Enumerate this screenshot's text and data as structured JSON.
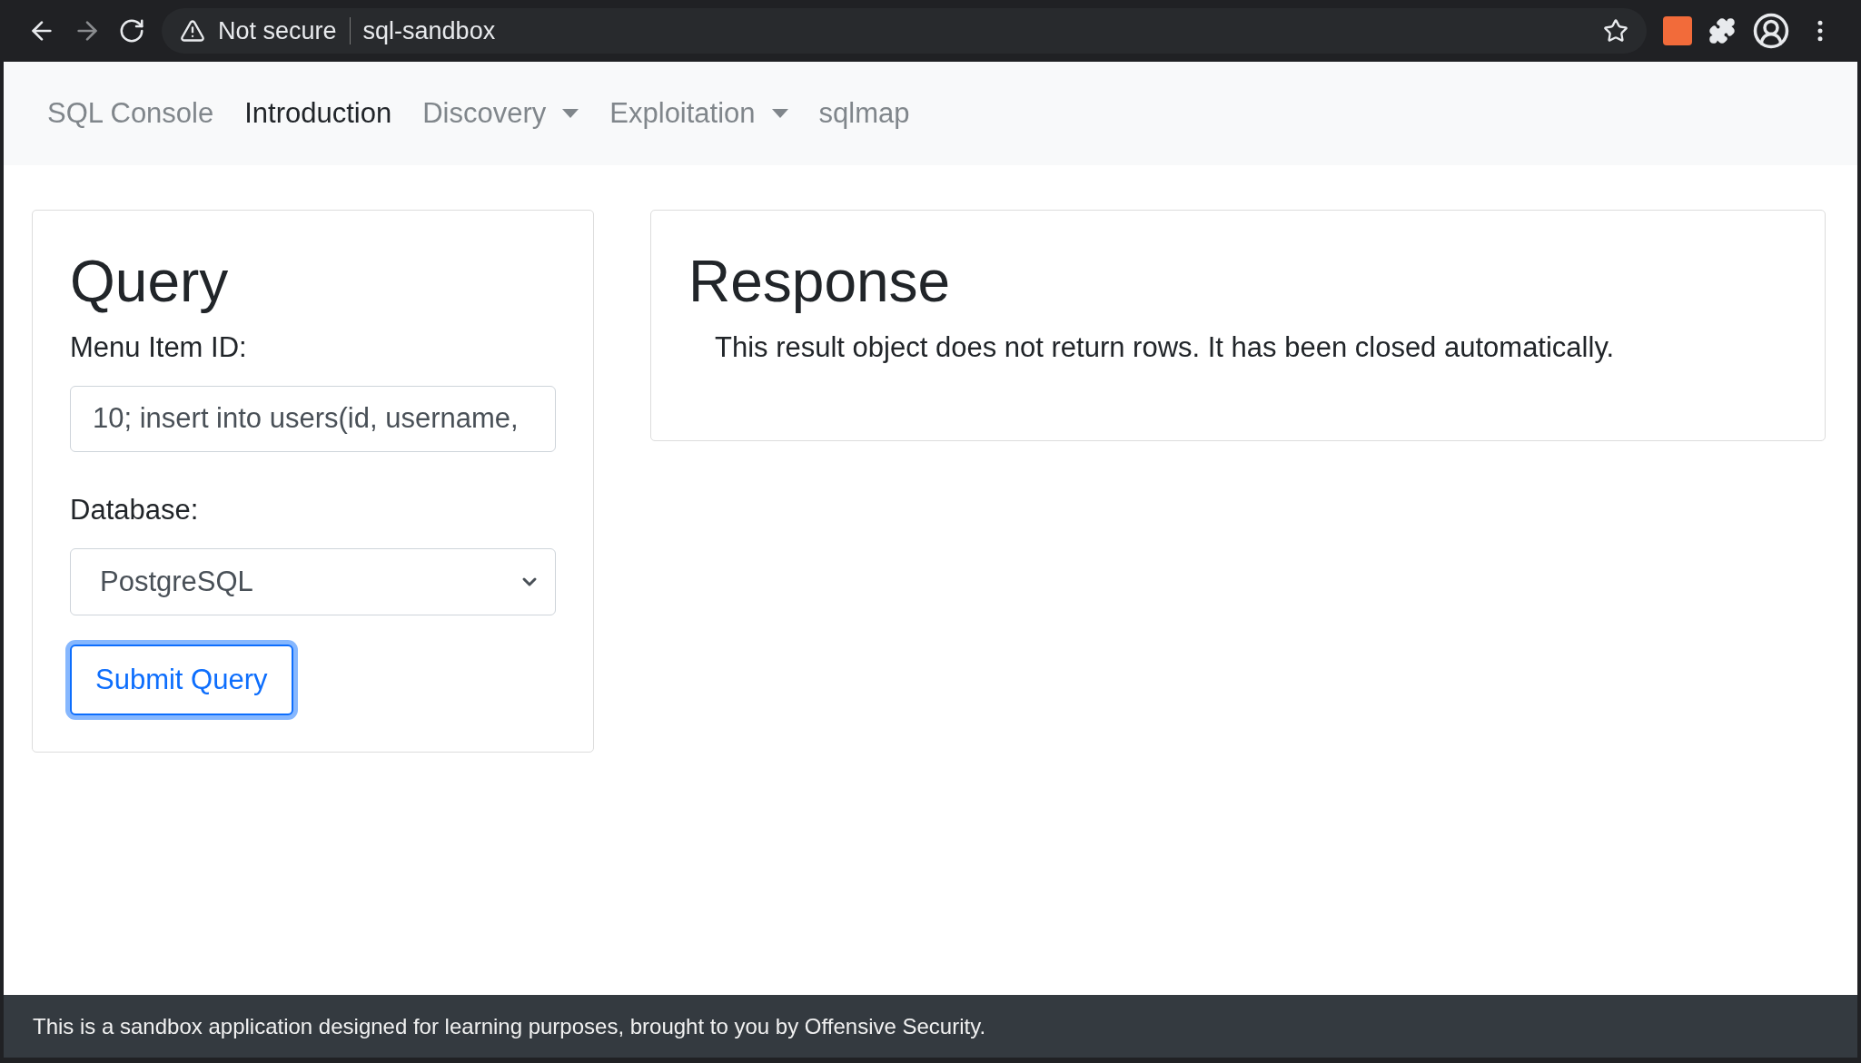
{
  "browser": {
    "security": "Not secure",
    "url": "sql-sandbox"
  },
  "nav": [
    {
      "label": "SQL Console",
      "selected": false,
      "kind": "link"
    },
    {
      "label": "Introduction",
      "selected": true,
      "kind": "link"
    },
    {
      "label": "Discovery",
      "selected": false,
      "kind": "dropdown"
    },
    {
      "label": "Exploitation",
      "selected": false,
      "kind": "dropdown"
    },
    {
      "label": "sqlmap",
      "selected": false,
      "kind": "link"
    }
  ],
  "query": {
    "title": "Query",
    "id_label": "Menu Item ID:",
    "id_value": "10; insert into users(id, username,",
    "db_label": "Database:",
    "db_value": "PostgreSQL",
    "submit": "Submit Query"
  },
  "response": {
    "title": "Response",
    "message": "This result object does not return rows. It has been closed automatically."
  },
  "footer": "This is a sandbox application designed for learning purposes, brought to you by Offensive Security."
}
